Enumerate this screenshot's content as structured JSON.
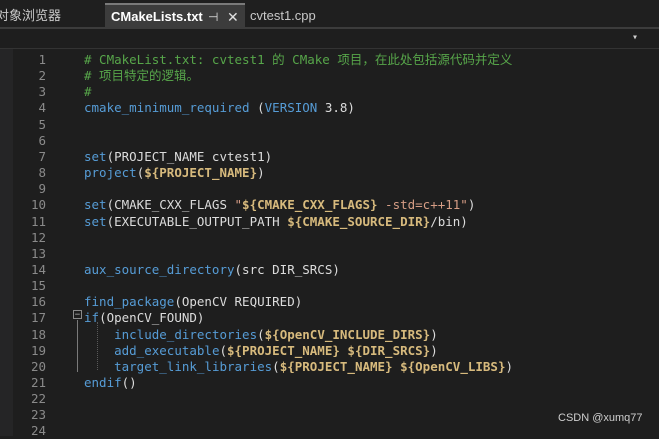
{
  "tabs": {
    "explorer": "对象浏览器",
    "active": "CMakeLists.txt",
    "pin": "⊣",
    "close": "✕",
    "second": "cvtest1.cpp"
  },
  "nav": {
    "dropdown_icon": "chevron-down-icon"
  },
  "colors": {
    "comment": "#57a64a",
    "keyword": "#569cd6",
    "variable": "#d7ba7d",
    "string": "#d69d85",
    "text": "#dcdcdc",
    "background": "#1e1e1e"
  },
  "lines": [
    {
      "n": "1",
      "tokens": [
        {
          "t": "# CMakeList.txt: cvtest1 的 CMake 项目，在此处包括源代码并定义",
          "c": "com"
        }
      ]
    },
    {
      "n": "2",
      "tokens": [
        {
          "t": "# 项目特定的逻辑。",
          "c": "com"
        }
      ]
    },
    {
      "n": "3",
      "tokens": [
        {
          "t": "#",
          "c": "com"
        }
      ]
    },
    {
      "n": "4",
      "tokens": [
        {
          "t": "cmake_minimum_required",
          "c": "fn"
        },
        {
          "t": " (",
          "c": "txt"
        },
        {
          "t": "VERSION",
          "c": "fn"
        },
        {
          "t": " 3.8)",
          "c": "txt"
        }
      ]
    },
    {
      "n": "5",
      "tokens": []
    },
    {
      "n": "6",
      "tokens": []
    },
    {
      "n": "7",
      "tokens": [
        {
          "t": "set",
          "c": "fn"
        },
        {
          "t": "(PROJECT_NAME cvtest1)",
          "c": "txt"
        }
      ]
    },
    {
      "n": "8",
      "tokens": [
        {
          "t": "project",
          "c": "fn"
        },
        {
          "t": "(",
          "c": "txt"
        },
        {
          "t": "${PROJECT_NAME}",
          "c": "var"
        },
        {
          "t": ")",
          "c": "txt"
        }
      ]
    },
    {
      "n": "9",
      "tokens": []
    },
    {
      "n": "10",
      "tokens": [
        {
          "t": "set",
          "c": "fn"
        },
        {
          "t": "(CMAKE_CXX_FLAGS ",
          "c": "txt"
        },
        {
          "t": "\"",
          "c": "str"
        },
        {
          "t": "${CMAKE_CXX_FLAGS}",
          "c": "var"
        },
        {
          "t": " -std=c++11\"",
          "c": "str"
        },
        {
          "t": ")",
          "c": "txt"
        }
      ]
    },
    {
      "n": "11",
      "tokens": [
        {
          "t": "set",
          "c": "fn"
        },
        {
          "t": "(EXECUTABLE_OUTPUT_PATH ",
          "c": "txt"
        },
        {
          "t": "${CMAKE_SOURCE_DIR}",
          "c": "var"
        },
        {
          "t": "/bin)",
          "c": "txt"
        }
      ]
    },
    {
      "n": "12",
      "tokens": []
    },
    {
      "n": "13",
      "tokens": []
    },
    {
      "n": "14",
      "tokens": [
        {
          "t": "aux_source_directory",
          "c": "fn"
        },
        {
          "t": "(src DIR_SRCS)",
          "c": "txt"
        }
      ]
    },
    {
      "n": "15",
      "tokens": []
    },
    {
      "n": "16",
      "tokens": [
        {
          "t": "find_package",
          "c": "fn"
        },
        {
          "t": "(OpenCV REQUIRED)",
          "c": "txt"
        }
      ]
    },
    {
      "n": "17",
      "tokens": [
        {
          "t": "if",
          "c": "fn"
        },
        {
          "t": "(OpenCV_FOUND)",
          "c": "txt"
        }
      ]
    },
    {
      "n": "18",
      "tokens": [
        {
          "t": "    ",
          "c": "txt"
        },
        {
          "t": "include_directories",
          "c": "fn"
        },
        {
          "t": "(",
          "c": "txt"
        },
        {
          "t": "${OpenCV_INCLUDE_DIRS}",
          "c": "var"
        },
        {
          "t": ")",
          "c": "txt"
        }
      ]
    },
    {
      "n": "19",
      "tokens": [
        {
          "t": "    ",
          "c": "txt"
        },
        {
          "t": "add_executable",
          "c": "fn"
        },
        {
          "t": "(",
          "c": "txt"
        },
        {
          "t": "${PROJECT_NAME}",
          "c": "var"
        },
        {
          "t": " ",
          "c": "txt"
        },
        {
          "t": "${DIR_SRCS}",
          "c": "var"
        },
        {
          "t": ")",
          "c": "txt"
        }
      ]
    },
    {
      "n": "20",
      "tokens": [
        {
          "t": "    ",
          "c": "txt"
        },
        {
          "t": "target_link_libraries",
          "c": "fn"
        },
        {
          "t": "(",
          "c": "txt"
        },
        {
          "t": "${PROJECT_NAME}",
          "c": "var"
        },
        {
          "t": " ",
          "c": "txt"
        },
        {
          "t": "${OpenCV_LIBS}",
          "c": "var"
        },
        {
          "t": ")",
          "c": "txt"
        }
      ]
    },
    {
      "n": "21",
      "tokens": [
        {
          "t": "endif",
          "c": "fn"
        },
        {
          "t": "()",
          "c": "txt"
        }
      ]
    },
    {
      "n": "22",
      "tokens": []
    },
    {
      "n": "23",
      "tokens": []
    },
    {
      "n": "24",
      "tokens": []
    }
  ],
  "fold": {
    "symbol": "−"
  },
  "watermark": "CSDN @xumq77"
}
